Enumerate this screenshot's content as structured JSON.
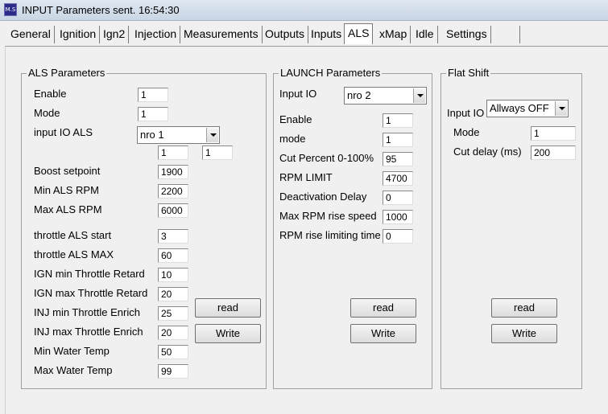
{
  "window": {
    "title": "INPUT Parameters sent. 16:54:30",
    "icon": "app-icon",
    "icon_text": "M.S"
  },
  "tabs": [
    "General",
    "Ignition",
    "Ign2",
    "Injection",
    "Measurements",
    "Outputs",
    "Inputs",
    "ALS",
    "xMap",
    "Idle",
    "Settings",
    ""
  ],
  "active_tab": "ALS",
  "als": {
    "title": "ALS Parameters",
    "enable_label": "Enable",
    "enable_value": "1",
    "mode_label": "Mode",
    "mode_value": "1",
    "input_io_label": "input IO ALS",
    "input_io_value": "nro 1",
    "io_box1": "1",
    "io_box2": "1",
    "boost_label": "Boost setpoint",
    "boost_value": "1900",
    "min_rpm_label": "Min ALS RPM",
    "min_rpm_value": "2200",
    "max_rpm_label": "Max ALS RPM",
    "max_rpm_value": "6000",
    "thr_start_label": "throttle ALS start",
    "thr_start_value": "3",
    "thr_max_label": "throttle ALS MAX",
    "thr_max_value": "60",
    "ign_min_label": "IGN min Throttle Retard",
    "ign_min_value": "10",
    "ign_max_label": "IGN max Throttle Retard",
    "ign_max_value": "20",
    "inj_min_label": "INJ min Throttle Enrich",
    "inj_min_value": "25",
    "inj_max_label": "INJ max Throttle Enrich",
    "inj_max_value": "20",
    "min_water_label": "Min Water Temp",
    "min_water_value": "50",
    "max_water_label": "Max Water Temp",
    "max_water_value": "99",
    "read_label": "read",
    "write_label": "Write"
  },
  "launch": {
    "title": "LAUNCH Parameters",
    "input_io_label": "Input IO",
    "input_io_value": "nro 2",
    "enable_label": "Enable",
    "enable_value": "1",
    "mode_label": "mode",
    "mode_value": "1",
    "cut_label": "Cut Percent 0-100%",
    "cut_value": "95",
    "rpm_limit_label": "RPM LIMIT",
    "rpm_limit_value": "4700",
    "deact_label": "Deactivation Delay",
    "deact_value": "0",
    "rise_label": "Max  RPM rise speed",
    "rise_value": "1000",
    "rise_time_label": "RPM rise limiting time",
    "rise_time_value": "0",
    "read_label": "read",
    "write_label": "Write"
  },
  "flat": {
    "title": "Flat Shift",
    "input_io_label": "Input IO",
    "input_io_value": "Allways OFF",
    "mode_label": "Mode",
    "mode_value": "1",
    "cut_delay_label": "Cut delay (ms)",
    "cut_delay_value": "200",
    "read_label": "read",
    "write_label": "Write"
  }
}
